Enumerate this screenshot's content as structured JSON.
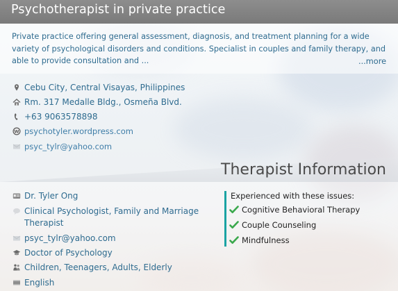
{
  "header": {
    "title": "Psychotherapist in private practice"
  },
  "description": {
    "text": "Private practice offering general assessment, diagnosis, and treatment planning for a wide variety of psychological disorders and conditions. Specialist in couples and family therapy, and able to provide consultation and ...",
    "more_label": "...more"
  },
  "contact": {
    "location": "Cebu City, Central Visayas, Philippines",
    "address": "Rm. 317 Medalle Bldg., Osmeña Blvd.",
    "phone": "+63 9063578898",
    "website": "psychotyler.wordpress.com",
    "email": "psyc_tylr@yahoo.com"
  },
  "therapist": {
    "section_title": "Therapist Information",
    "name": "Dr. Tyler Ong",
    "title_line1": "Clinical Psychologist, Family and Marriage",
    "title_line2": "Therapist",
    "email": "psyc_tylr@yahoo.com",
    "degree": "Doctor of Psychology",
    "ages": "Children, Teenagers, Adults, Elderly",
    "language": "English"
  },
  "issues": {
    "heading": "Experienced with these issues:",
    "items": [
      "Cognitive Behavioral Therapy",
      "Couple Counseling",
      "Mindfulness"
    ]
  },
  "colors": {
    "header_bg": "#7f7f7f",
    "link": "#2e6b8f",
    "check": "#3aa84c",
    "accent_bar": "#1aa3a3"
  }
}
